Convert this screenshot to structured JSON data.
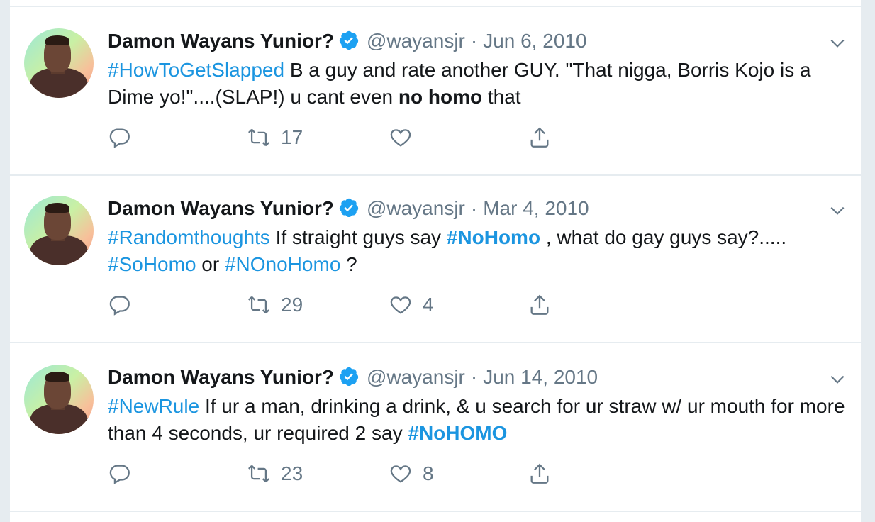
{
  "tweets": [
    {
      "name": "Damon Wayans Yunior?",
      "handle": "@wayansjr",
      "separator": "·",
      "date": "Jun 6, 2010",
      "text": {
        "p1": "#HowToGetSlapped",
        "p2": " B a guy and rate another GUY. \"That nigga, Borris Kojo is a Dime yo!\"....(SLAP!) u cant even ",
        "p3": "no homo",
        "p4": " that"
      },
      "retweets": "17",
      "likes": ""
    },
    {
      "name": "Damon Wayans Yunior?",
      "handle": "@wayansjr",
      "separator": "·",
      "date": "Mar 4, 2010",
      "text": {
        "p1": "#Randomthoughts",
        "p2": " If straight guys say ",
        "p3": "#NoHomo",
        "p4": " , what do gay guys say?..... ",
        "p5": "#SoHomo",
        "p6": " or ",
        "p7": "#NOnoHomo",
        "p8": " ?"
      },
      "retweets": "29",
      "likes": "4"
    },
    {
      "name": "Damon Wayans Yunior?",
      "handle": "@wayansjr",
      "separator": "·",
      "date": "Jun 14, 2010",
      "text": {
        "p1": "#NewRule",
        "p2": " If ur a man, drinking a drink, & u search for ur straw w/ ur mouth for more than 4 seconds, ur required 2 say ",
        "p3": "#NoHOMO"
      },
      "retweets": "23",
      "likes": "8"
    }
  ],
  "icons": {
    "verified": "verified-badge-icon",
    "caret": "chevron-down-icon",
    "reply": "reply-icon",
    "retweet": "retweet-icon",
    "like": "heart-icon",
    "share": "share-icon"
  },
  "colors": {
    "accent": "#1b95e0",
    "muted": "#657786",
    "text": "#14171a",
    "background": "#e6ecf0"
  }
}
